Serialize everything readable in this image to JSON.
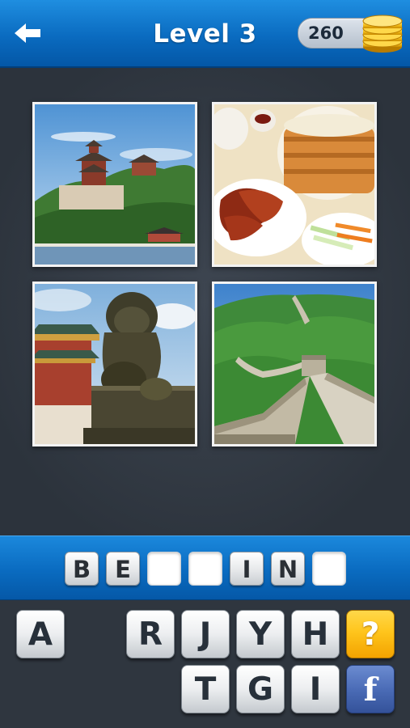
{
  "header": {
    "back_icon": "arrow-left-icon",
    "title": "Level 3",
    "coins": "260",
    "coin_icon": "coin-stack-icon"
  },
  "puzzle": {
    "images": [
      {
        "name": "summer-palace-photo",
        "description_icon": "pagoda-on-hill-icon"
      },
      {
        "name": "peking-duck-photo",
        "description_icon": "food-plate-icon"
      },
      {
        "name": "guardian-lion-photo",
        "description_icon": "lion-statue-icon"
      },
      {
        "name": "great-wall-photo",
        "description_icon": "wall-mountains-icon"
      }
    ]
  },
  "answer": {
    "slots": [
      "B",
      "E",
      "",
      "",
      "I",
      "N",
      ""
    ]
  },
  "keyboard": {
    "row1": [
      "A",
      "",
      "R",
      "J",
      "Y",
      "H"
    ],
    "row2": [
      "",
      "",
      "T",
      "G",
      "I"
    ],
    "hint_label": "?",
    "facebook_label": "f"
  },
  "colors": {
    "header_blue": "#0a6bc0",
    "background": "#323a44",
    "hint_yellow": "#ffc51c",
    "facebook_blue": "#4b6cb7"
  }
}
